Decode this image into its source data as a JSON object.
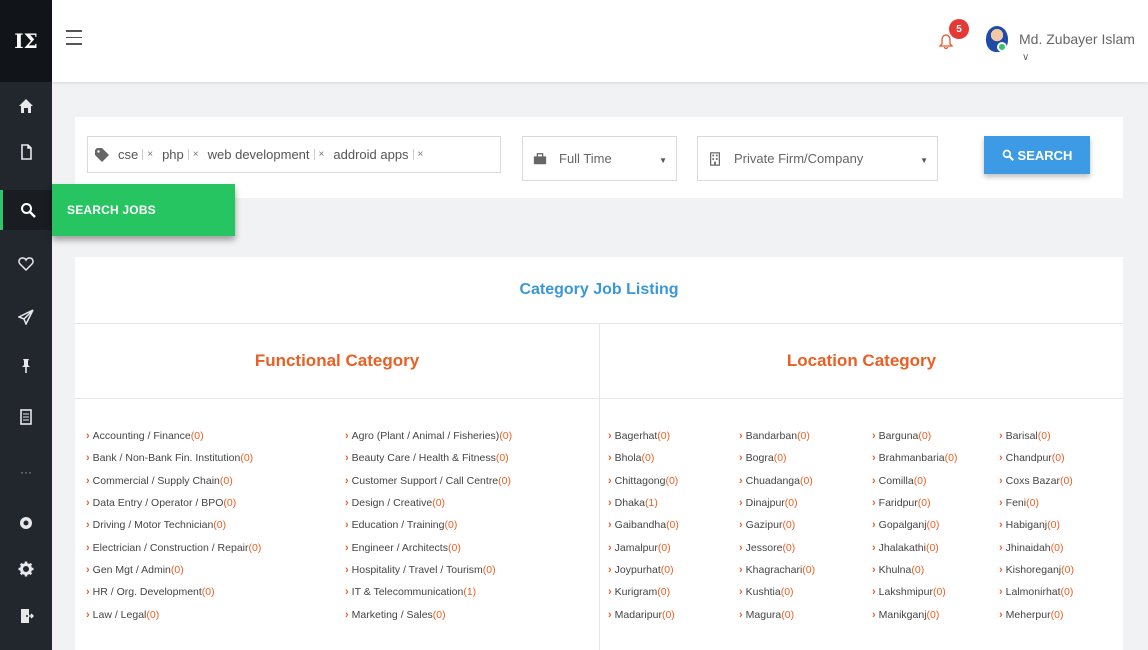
{
  "app": {
    "logo_text": "ΙΣ"
  },
  "header": {
    "notification_count": "5",
    "user_name": "Md. Zubayer Islam",
    "user_caret": "∨"
  },
  "sidebar": {
    "more_text": "···",
    "flyout_label": "SEARCH JOBS"
  },
  "search": {
    "tags": [
      "cse",
      "php",
      "web development",
      "addroid apps"
    ],
    "job_type": "Full Time",
    "org_type": "Private Firm/Company",
    "button_label": "SEARCH"
  },
  "listing": {
    "title": "Category Job Listing",
    "functional_header": "Functional Category",
    "location_header": "Location Category",
    "functional_col1": [
      {
        "name": "Accounting / Finance",
        "count": "(0)"
      },
      {
        "name": "Bank / Non-Bank Fin. Institution",
        "count": "(0)"
      },
      {
        "name": "Commercial / Supply Chain",
        "count": "(0)"
      },
      {
        "name": "Data Entry / Operator / BPO",
        "count": "(0)"
      },
      {
        "name": "Driving / Motor Technician",
        "count": "(0)"
      },
      {
        "name": "Electrician / Construction / Repair",
        "count": "(0)"
      },
      {
        "name": "Gen Mgt / Admin",
        "count": "(0)"
      },
      {
        "name": "HR / Org. Development",
        "count": "(0)"
      },
      {
        "name": "Law / Legal",
        "count": "(0)"
      }
    ],
    "functional_col2": [
      {
        "name": "Agro (Plant / Animal / Fisheries)",
        "count": "(0)"
      },
      {
        "name": "Beauty Care / Health & Fitness",
        "count": "(0)"
      },
      {
        "name": "Customer Support / Call Centre",
        "count": "(0)"
      },
      {
        "name": "Design / Creative",
        "count": "(0)"
      },
      {
        "name": "Education / Training",
        "count": "(0)"
      },
      {
        "name": "Engineer / Architects",
        "count": "(0)"
      },
      {
        "name": "Hospitality / Travel / Tourism",
        "count": "(0)"
      },
      {
        "name": "IT & Telecommunication",
        "count": "(1)"
      },
      {
        "name": "Marketing / Sales",
        "count": "(0)"
      }
    ],
    "location_col1": [
      {
        "name": "Bagerhat",
        "count": "(0)"
      },
      {
        "name": "Bhola",
        "count": "(0)"
      },
      {
        "name": "Chittagong",
        "count": "(0)"
      },
      {
        "name": "Dhaka",
        "count": "(1)"
      },
      {
        "name": "Gaibandha",
        "count": "(0)"
      },
      {
        "name": "Jamalpur",
        "count": "(0)"
      },
      {
        "name": "Joypurhat",
        "count": "(0)"
      },
      {
        "name": "Kurigram",
        "count": "(0)"
      },
      {
        "name": "Madaripur",
        "count": "(0)"
      }
    ],
    "location_col2": [
      {
        "name": "Bandarban",
        "count": "(0)"
      },
      {
        "name": "Bogra",
        "count": "(0)"
      },
      {
        "name": "Chuadanga",
        "count": "(0)"
      },
      {
        "name": "Dinajpur",
        "count": "(0)"
      },
      {
        "name": "Gazipur",
        "count": "(0)"
      },
      {
        "name": "Jessore",
        "count": "(0)"
      },
      {
        "name": "Khagrachari",
        "count": "(0)"
      },
      {
        "name": "Kushtia",
        "count": "(0)"
      },
      {
        "name": "Magura",
        "count": "(0)"
      }
    ],
    "location_col3": [
      {
        "name": "Barguna",
        "count": "(0)"
      },
      {
        "name": "Brahmanbaria",
        "count": "(0)"
      },
      {
        "name": "Comilla",
        "count": "(0)"
      },
      {
        "name": "Faridpur",
        "count": "(0)"
      },
      {
        "name": "Gopalganj",
        "count": "(0)"
      },
      {
        "name": "Jhalakathi",
        "count": "(0)"
      },
      {
        "name": "Khulna",
        "count": "(0)"
      },
      {
        "name": "Lakshmipur",
        "count": "(0)"
      },
      {
        "name": "Manikganj",
        "count": "(0)"
      }
    ],
    "location_col4": [
      {
        "name": "Barisal",
        "count": "(0)"
      },
      {
        "name": "Chandpur",
        "count": "(0)"
      },
      {
        "name": "Coxs Bazar",
        "count": "(0)"
      },
      {
        "name": "Feni",
        "count": "(0)"
      },
      {
        "name": "Habiganj",
        "count": "(0)"
      },
      {
        "name": "Jhinaidah",
        "count": "(0)"
      },
      {
        "name": "Kishoreganj",
        "count": "(0)"
      },
      {
        "name": "Lalmonirhat",
        "count": "(0)"
      },
      {
        "name": "Meherpur",
        "count": "(0)"
      }
    ]
  },
  "colors": {
    "accent_green": "#27c562",
    "accent_blue": "#3c9be4",
    "accent_orange": "#ea5f23",
    "sidebar_bg": "#22272e"
  },
  "icons": [
    "home-icon",
    "file-icon",
    "search-icon",
    "heart-icon",
    "send-icon",
    "pin-icon",
    "document-icon",
    "eye-icon",
    "gear-icon",
    "logout-icon",
    "bell-icon",
    "tag-icon",
    "briefcase-icon",
    "building-icon"
  ]
}
